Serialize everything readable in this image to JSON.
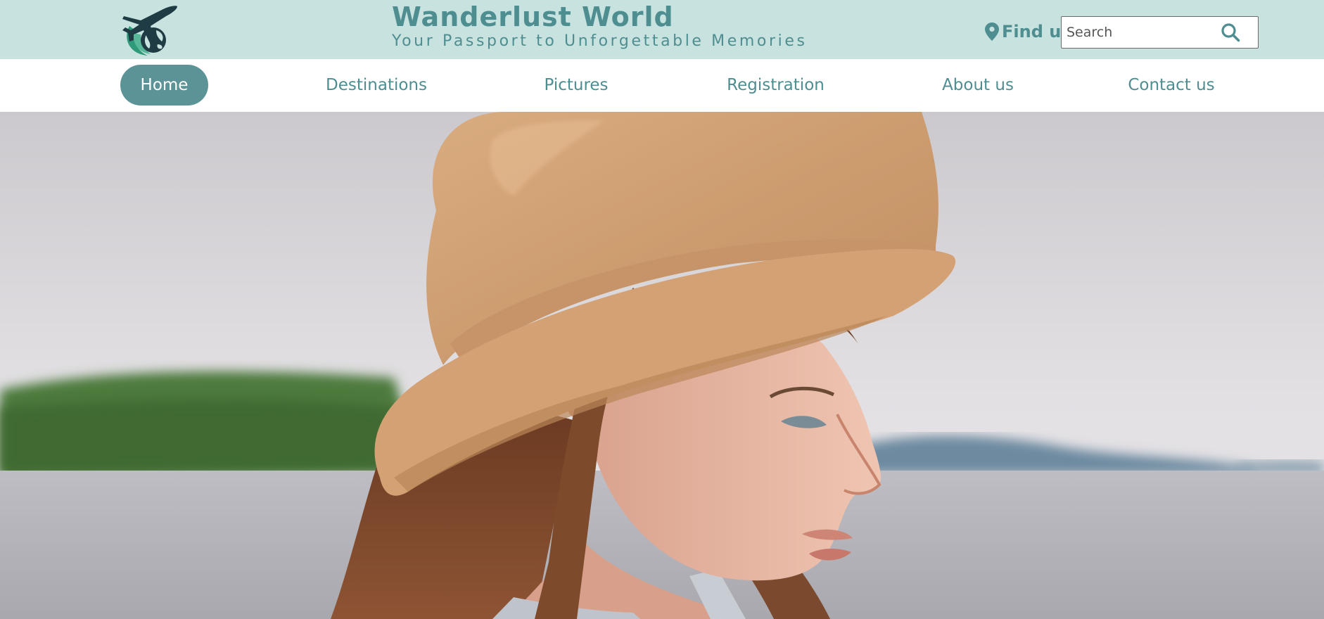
{
  "header": {
    "site_title": "Wanderlust World",
    "tagline": "Your Passport to Unforgettable Memories",
    "logo_icon": "airplane-globe-icon",
    "find_us_label": "Find us",
    "find_us_icon": "map-pin-icon",
    "search": {
      "placeholder": "Search",
      "value": "",
      "icon": "search-icon"
    }
  },
  "nav": {
    "items": [
      {
        "label": "Home",
        "active": true
      },
      {
        "label": "Destinations",
        "active": false
      },
      {
        "label": "Pictures",
        "active": false
      },
      {
        "label": "Registration",
        "active": false
      },
      {
        "label": "About us",
        "active": false
      },
      {
        "label": "Contact us",
        "active": false
      }
    ]
  },
  "hero": {
    "image": "hero-photo"
  },
  "colors": {
    "header_bg": "#c7e2df",
    "brand_teal": "#4e8e91",
    "active_pill": "#5b9396",
    "nav_bg": "#ffffff"
  }
}
